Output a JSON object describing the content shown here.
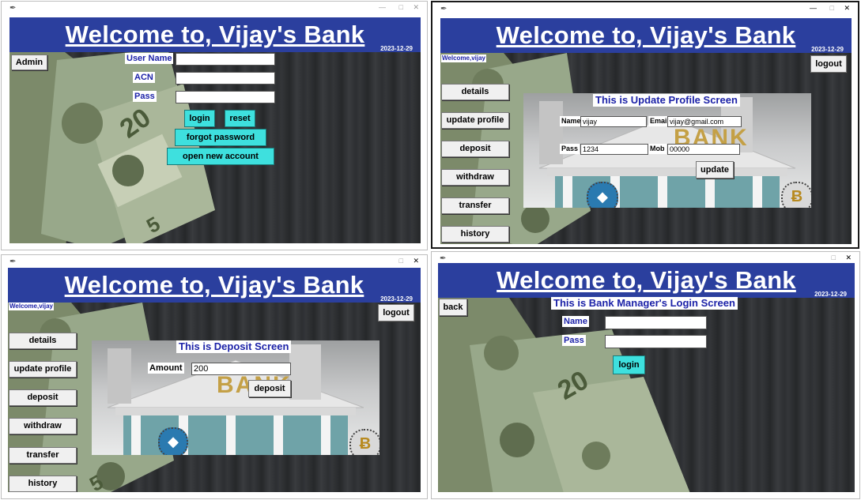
{
  "app": {
    "title": "Welcome to, Vijay's Bank",
    "date": "2023-12-29",
    "window_glyph": "tk"
  },
  "window_login": {
    "admin_button": "Admin",
    "user_name_label": "User Name",
    "acn_label": "ACN",
    "pass_label": "Pass",
    "user_name_value": "",
    "acn_value": "",
    "pass_value": "",
    "login_button": "login",
    "reset_button": "reset",
    "forgot_button": "forgot password",
    "open_account_button": "open new account"
  },
  "window_update": {
    "welcome": "Welcome,vijay",
    "logout_button": "logout",
    "sidebar": [
      "details",
      "update profile",
      "deposit",
      "withdraw",
      "transfer",
      "history"
    ],
    "screen_title": "This is Update Profile Screen",
    "name_label": "Name",
    "name_value": "vijay",
    "email_label": "Email",
    "email_value": "vijay@gmail.com",
    "pass_label": "Pass",
    "pass_value": "1234",
    "mob_label": "Mob",
    "mob_value": "00000",
    "update_button": "update",
    "bank_sign": "BANK"
  },
  "window_deposit": {
    "welcome": "Welcome,vijay",
    "logout_button": "logout",
    "sidebar": [
      "details",
      "update profile",
      "deposit",
      "withdraw",
      "transfer",
      "history"
    ],
    "screen_title": "This is Deposit Screen",
    "amount_label": "Amount",
    "amount_value": "200",
    "deposit_button": "deposit",
    "bank_sign": "BANK"
  },
  "window_manager": {
    "back_button": "back",
    "screen_title": "This is Bank Manager's Login Screen",
    "name_label": "Name",
    "pass_label": "Pass",
    "name_value": "",
    "pass_value": "",
    "login_button": "login"
  },
  "colors": {
    "header_blue": "#2b3f9e",
    "label_blue": "#1c22a8",
    "cyan_button": "#3ee0de",
    "board_dark": "#2c2e31"
  },
  "icons": [
    "tk-feather-icon",
    "minimize-icon",
    "maximize-icon",
    "close-icon",
    "ethereum-icon",
    "bitcoin-icon"
  ]
}
